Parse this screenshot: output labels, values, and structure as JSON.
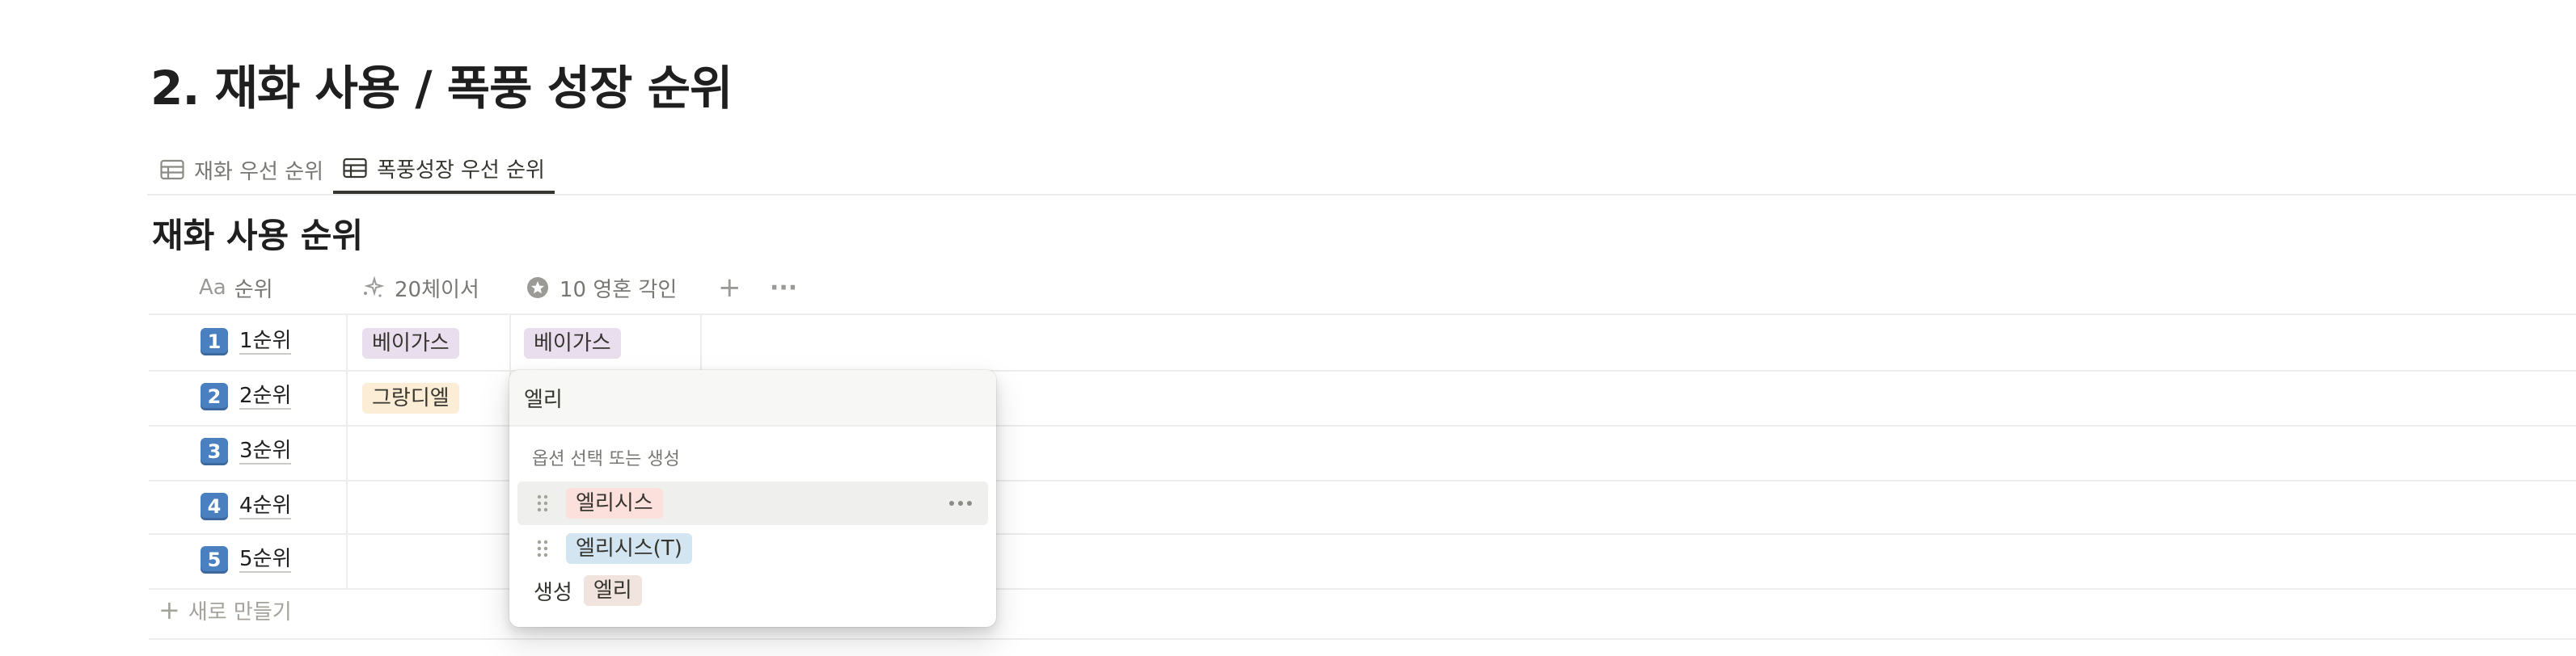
{
  "page": {
    "title": "2. 재화 사용 / 폭풍 성장 순위"
  },
  "tabs": [
    {
      "label": "재화 우선 순위",
      "active": false,
      "icon": "table-icon"
    },
    {
      "label": "폭풍성장 우선 순위",
      "active": true,
      "icon": "table-icon"
    }
  ],
  "database": {
    "title": "재화 사용 순위"
  },
  "columns": {
    "rank": {
      "icon_text": "Aa",
      "label": "순위"
    },
    "col1": {
      "icon": "sparkle-icon",
      "label": "20체이서"
    },
    "col2": {
      "icon": "star-badge-icon",
      "label": "10 영혼 각인"
    },
    "add": "+",
    "more": "···"
  },
  "rows": [
    {
      "num": "1",
      "label": "1순위",
      "col1": "베이가스",
      "col2": "베이가스"
    },
    {
      "num": "2",
      "label": "2순위",
      "col1": "그랑디엘",
      "col2": ""
    },
    {
      "num": "3",
      "label": "3순위",
      "col1": "",
      "col2": ""
    },
    {
      "num": "4",
      "label": "4순위",
      "col1": "",
      "col2": ""
    },
    {
      "num": "5",
      "label": "5순위",
      "col1": "",
      "col2": ""
    }
  ],
  "new_row": {
    "label": "새로 만들기"
  },
  "popup": {
    "input_value": "엘리",
    "hint": "옵션 선택 또는 생성",
    "options": [
      {
        "label": "엘리시스",
        "color": "#fbe0dc"
      },
      {
        "label": "엘리시스(T)",
        "color": "#d3e5f1"
      }
    ],
    "create_label": "생성",
    "create_value": "엘리"
  },
  "colors": {
    "tag_purple": "#e8deee",
    "tag_yellow": "#fbedd6",
    "rank_badge": "#4a7fc0"
  }
}
